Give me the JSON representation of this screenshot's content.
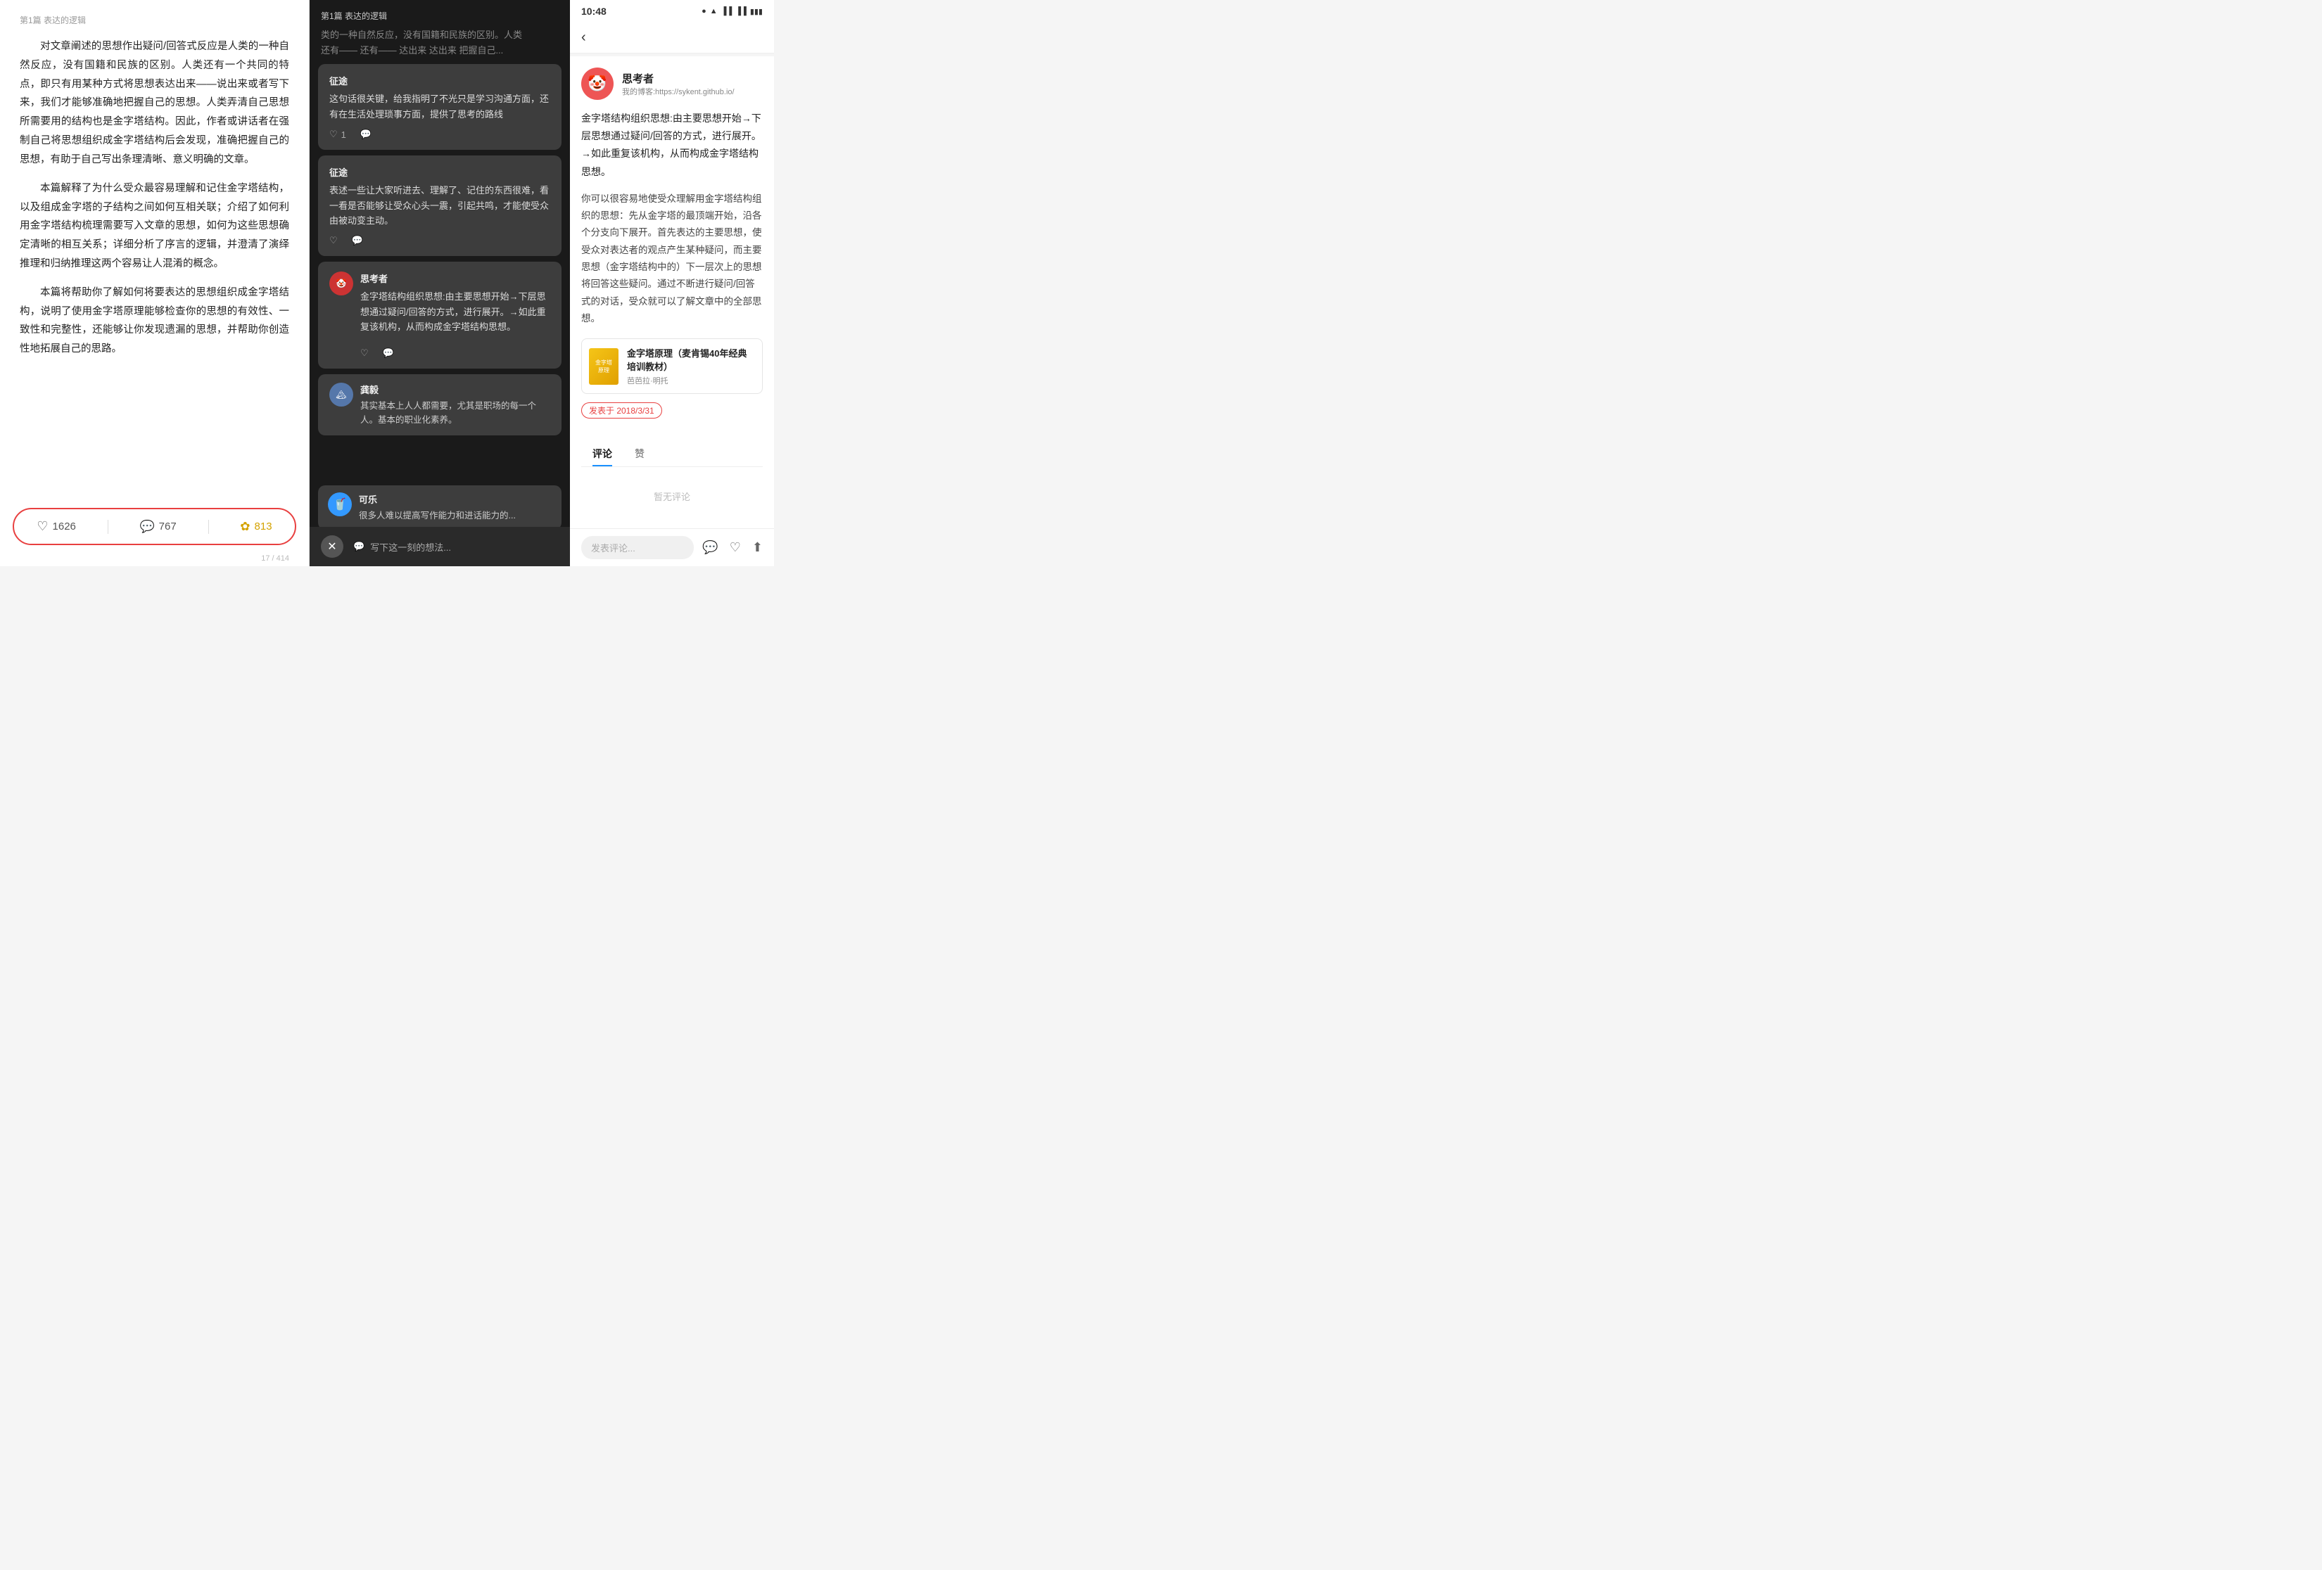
{
  "panel1": {
    "breadcrumb": "第1篇 表达的逻辑",
    "paragraphs": [
      "对文章阐述的思想作出疑问/回答式反应是人类的一种自然反应，没有国籍和民族的区别。人类还有一个共同的特点，即只有用某种方式将思想表达出来——说出来或者写下来，我们才能够准确地把握自己的思想。人类弄清自己思想所需要用的结构也是金字塔结构。因此，作者或讲话者在强制自己将思想组织成金字塔结构后会发现，准确把握自己的思想，有助于自己写出条理清晰、意义明确的文章。",
      "本篇解释了为什么受众最容易理解和记住金字塔结构，以及组成金字塔的子结构之间如何互相关联；介绍了如何利用金字塔结构梳理需要写入文章的思想，如何为这些思想确定清晰的相互关系；详细分析了序言的逻辑，并澄清了演绎推理和归纳推理这两个容易让人混淆的概念。",
      "本篇将帮助你了解如何将要表达的思想组织成金字塔结构，说明了使用金字塔原理能够检查你的思想的有效性、一致性和完整性，还能够让你发现遗漏的思想，并帮助你创造性地拓展自己的思路。"
    ],
    "actions": {
      "like": "1626",
      "comment": "767",
      "share": "813"
    },
    "pagination": "17 / 414"
  },
  "panel2": {
    "breadcrumb": "第1篇 表达的逻辑",
    "blurred_text": "类的一种自然反应，没有国籍和民族的区别。人类还有——还有——达出来达出来把握自己...",
    "comments": [
      {
        "id": "c1",
        "title": "征途",
        "text": "这句话很关键，给我指明了不光只是学习沟通方面，还有在生活处理琐事方面，提供了思考的路线",
        "likes": "1",
        "has_reply": true
      },
      {
        "id": "c2",
        "title": "征途",
        "text": "表述一些让大家听进去、理解了、记住的东西很难，看一看是否能够让受众心头一震，引起共鸣，才能使受众由被动变主动。",
        "likes": "",
        "has_reply": true
      },
      {
        "id": "c3",
        "title": "思考者",
        "text": "金字塔结构组织思想:由主要思想开始→下层思想通过疑问/回答的方式，进行展开。→如此重复该机构，从而构成金字塔结构思想。",
        "likes": "",
        "has_reply": true
      }
    ],
    "more_comment": {
      "name": "龚毅",
      "avatar_text": "🏔",
      "text": "其实基本上人人都需要，尤其是职场的每一个人。基本的职业化素养。"
    },
    "bottom_bar": {
      "close_label": "×",
      "write_placeholder": "写下这一刻的想法..."
    },
    "partial_comment": {
      "name": "可乐",
      "text": "很多人难以提高写作能力和进话能力的..."
    }
  },
  "panel3": {
    "status_bar": {
      "time": "10:48",
      "icons": [
        "●",
        "□",
        "WiFi",
        "signal",
        "battery"
      ]
    },
    "author": {
      "name": "思考者",
      "blog": "我的博客:https://sykent.github.io/",
      "avatar_emoji": "🤡"
    },
    "main_text": "金字塔结构组织思想:由主要思想开始→下层思想通过疑问/回答的方式，进行展开。→如此重复该机构，从而构成金字塔结构思想。",
    "sub_text": "你可以很容易地使受众理解用金字塔结构组织的思想：先从金字塔的最顶端开始，沿各个分支向下展开。首先表达的主要思想，使受众对表达者的观点产生某种疑问，而主要思想（金字塔结构中的）下一层次上的思想将回答这些疑问。通过不断进行疑问/回答式的对话，受众就可以了解文章中的全部思想。",
    "book": {
      "title": "金字塔原理（麦肯锡40年经典培训教材）",
      "author": "芭芭拉·明托",
      "cover_text": "金字塔原理"
    },
    "publish_date": "发表于 2018/3/31",
    "tabs": {
      "comment": "评论",
      "like": "赞"
    },
    "no_comment": "暂无评论",
    "comment_placeholder": "发表评论...",
    "bottom_icons": [
      "💬",
      "♡",
      "⬆"
    ]
  }
}
